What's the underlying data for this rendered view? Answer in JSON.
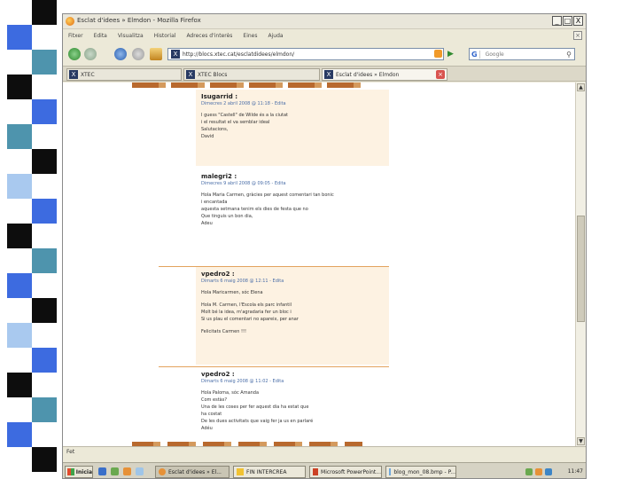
{
  "colors": {
    "strip_blue": "#3d6be0",
    "strip_black": "#0d0d0d",
    "strip_teal": "#4e94ad",
    "strip_light": "#a9c9ef",
    "comment_bg": "#fdf2e2",
    "accent_orange": "#e3a35e"
  },
  "strip": [
    {
      "col": "b",
      "color": "#0d0d0d"
    },
    {
      "col": "a",
      "color": "#3d6be0"
    },
    {
      "col": "b",
      "color": "#4e94ad"
    },
    {
      "col": "a",
      "color": "#0d0d0d"
    },
    {
      "col": "b",
      "color": "#3d6be0"
    },
    {
      "col": "a",
      "color": "#4e94ad"
    },
    {
      "col": "b",
      "color": "#0d0d0d"
    },
    {
      "col": "a",
      "color": "#a9c9ef"
    },
    {
      "col": "b",
      "color": "#3d6be0"
    },
    {
      "col": "a",
      "color": "#0d0d0d"
    },
    {
      "col": "b",
      "color": "#4e94ad"
    },
    {
      "col": "a",
      "color": "#3d6be0"
    },
    {
      "col": "b",
      "color": "#0d0d0d"
    },
    {
      "col": "a",
      "color": "#a9c9ef"
    },
    {
      "col": "b",
      "color": "#3d6be0"
    },
    {
      "col": "a",
      "color": "#0d0d0d"
    },
    {
      "col": "b",
      "color": "#4e94ad"
    },
    {
      "col": "a",
      "color": "#3d6be0"
    },
    {
      "col": "b",
      "color": "#0d0d0d"
    }
  ],
  "window": {
    "title": "Esclat d'idees » Elmdon - Mozilla Firefox",
    "minimize": "_",
    "maximize": "□",
    "close": "X"
  },
  "menu": [
    "Fitxer",
    "Edita",
    "Visualitza",
    "Historial",
    "Adreces d'interès",
    "Eines",
    "Ajuda"
  ],
  "nav": {
    "back_icon": "arrow-left-icon",
    "forward_icon": "arrow-right-icon",
    "url_favicon": "X",
    "url": "http://blocs.xtec.cat/esclatdidees/elmdon/",
    "search_placeholder": "Google",
    "search_engine_glyph": "G"
  },
  "tabs": [
    {
      "label": "XTEC",
      "active": false
    },
    {
      "label": "XTEC Blocs",
      "active": false
    },
    {
      "label": "Esclat d'idees » Elmdon",
      "active": true
    }
  ],
  "comments": [
    {
      "author": "Isugarrid :",
      "meta": "Dimecres 2 abril 2008 @ 11:18 - Edita",
      "lines": [
        "I guess \"Castell\" de Wilde és a la ciutat",
        "i el resultat el va semblar ideal",
        "Salutacions,",
        "David"
      ]
    },
    {
      "author": "malegri2 :",
      "meta": "Dimecres 9 abril 2008 @ 09:05 - Edita",
      "lines": [
        "Hola Maria Carmen, gràcies per aquest comentari tan bonic",
        "i encantada",
        "aquesta setmana tenim els dies de festa que no",
        "Que tinguis un bon dia,",
        "Adeu"
      ]
    },
    {
      "author": "vpedro2 :",
      "meta": "Dimarts 6 maig 2008 @ 12:11 - Edita",
      "lines": [
        "Hola Maricarmen, sóc Elena",
        "",
        "Hola M. Carmen, l'Escola els parc infantil",
        "Molt bé la idea, m'agradaria fer un bloc i",
        "Si us plau el comentari no apareix, per anar",
        "Felicitats Carmen !!!"
      ]
    },
    {
      "author": "vpedro2 :",
      "meta": "Dimarts 6 maig 2008 @ 11:02 - Edita",
      "lines": [
        "Hola Paloma, sóc Amanda",
        "Com estàs?",
        "Una de les coses per fer aquest dia ha estat que",
        "ha costat",
        "De les dues activitats que vaig fer ja us en parlaré",
        "Adéu"
      ]
    }
  ],
  "status": "Fet",
  "taskbar": {
    "start_label": "Inicia",
    "tasks": [
      {
        "label": "Esclat d'idees » El...",
        "active": true
      },
      {
        "label": "FIN INTERCREA",
        "active": false
      },
      {
        "label": "Microsoft PowerPoint...",
        "active": false
      },
      {
        "label": "blog_mon_08.bmp - P...",
        "active": false
      }
    ],
    "clock": "11:47"
  }
}
